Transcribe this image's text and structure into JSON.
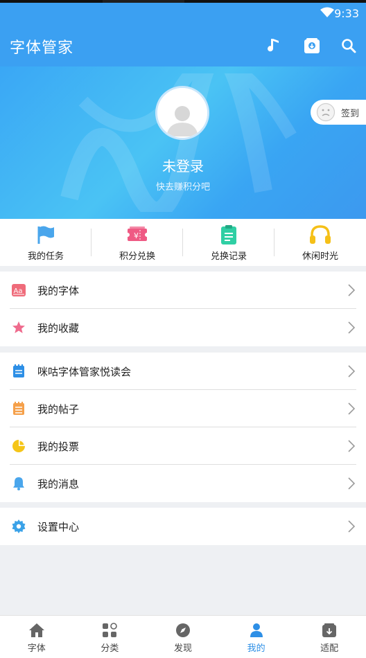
{
  "status": {
    "time": "9:33"
  },
  "appbar": {
    "title": "字体管家"
  },
  "profile": {
    "status": "未登录",
    "hint": "快去赚积分吧",
    "signin_label": "签到"
  },
  "quick": [
    {
      "label": "我的任务",
      "icon": "flag-icon",
      "color": "#4aa6ec"
    },
    {
      "label": "积分兑换",
      "icon": "ticket-icon",
      "color": "#ef5a84"
    },
    {
      "label": "兑换记录",
      "icon": "clipboard-icon",
      "color": "#2fcfa4"
    },
    {
      "label": "休闲时光",
      "icon": "headphones-icon",
      "color": "#f5c018"
    }
  ],
  "menu": {
    "group1": [
      {
        "label": "我的字体",
        "icon": "font-icon"
      },
      {
        "label": "我的收藏",
        "icon": "star-icon"
      }
    ],
    "group2": [
      {
        "label": "咪咕字体管家悦读会",
        "icon": "notebook-icon"
      },
      {
        "label": "我的帖子",
        "icon": "post-icon"
      },
      {
        "label": "我的投票",
        "icon": "pie-icon"
      },
      {
        "label": "我的消息",
        "icon": "bell-icon"
      }
    ],
    "group3": [
      {
        "label": "设置中心",
        "icon": "gear-icon"
      }
    ]
  },
  "tabs": [
    {
      "label": "字体",
      "icon": "home-icon"
    },
    {
      "label": "分类",
      "icon": "category-icon"
    },
    {
      "label": "发现",
      "icon": "compass-icon"
    },
    {
      "label": "我的",
      "icon": "person-icon",
      "active": true
    },
    {
      "label": "适配",
      "icon": "download-box-icon"
    }
  ],
  "colors": {
    "primary": "#3ba0f2",
    "active_tab": "#2d8fe6"
  }
}
